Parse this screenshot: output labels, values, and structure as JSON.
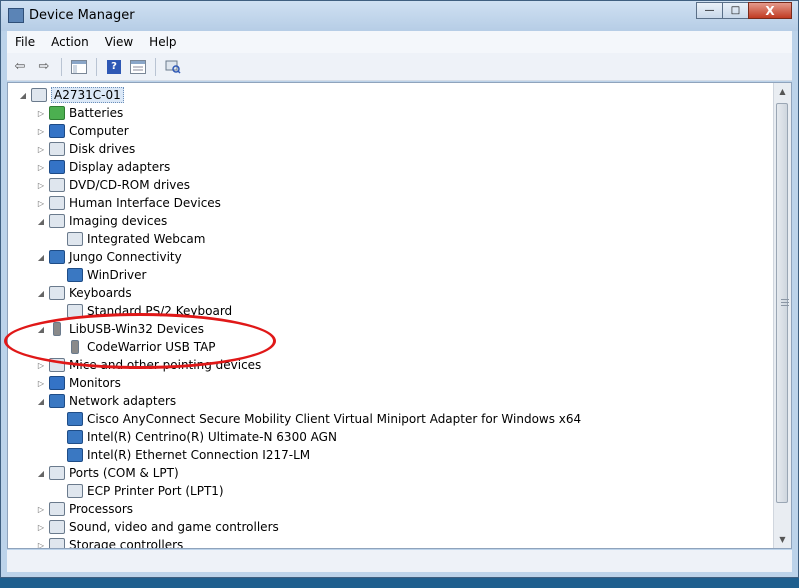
{
  "window": {
    "title": "Device Manager",
    "minimize_glyph": "—",
    "maximize_glyph": "□",
    "close_glyph": "X"
  },
  "menu": [
    "File",
    "Action",
    "View",
    "Help"
  ],
  "toolbar": {
    "back_glyph": "⇦",
    "forward_glyph": "⇨",
    "help_glyph": "?"
  },
  "tree": [
    {
      "label": "A2731C-01",
      "depth": 0,
      "expander": "◢",
      "icon": "computer-icon",
      "selected": true
    },
    {
      "label": "Batteries",
      "depth": 1,
      "expander": "▷",
      "icon": "battery-icon"
    },
    {
      "label": "Computer",
      "depth": 1,
      "expander": "▷",
      "icon": "monitor-icon"
    },
    {
      "label": "Disk drives",
      "depth": 1,
      "expander": "▷",
      "icon": "disk-drive-icon"
    },
    {
      "label": "Display adapters",
      "depth": 1,
      "expander": "▷",
      "icon": "display-adapter-icon"
    },
    {
      "label": "DVD/CD-ROM drives",
      "depth": 1,
      "expander": "▷",
      "icon": "dvd-drive-icon"
    },
    {
      "label": "Human Interface Devices",
      "depth": 1,
      "expander": "▷",
      "icon": "hid-icon"
    },
    {
      "label": "Imaging devices",
      "depth": 1,
      "expander": "◢",
      "icon": "camera-icon"
    },
    {
      "label": "Integrated Webcam",
      "depth": 2,
      "expander": "",
      "icon": "camera-icon"
    },
    {
      "label": "Jungo Connectivity",
      "depth": 1,
      "expander": "◢",
      "icon": "network-icon"
    },
    {
      "label": "WinDriver",
      "depth": 2,
      "expander": "",
      "icon": "network-icon"
    },
    {
      "label": "Keyboards",
      "depth": 1,
      "expander": "◢",
      "icon": "keyboard-icon"
    },
    {
      "label": "Standard PS/2 Keyboard",
      "depth": 2,
      "expander": "",
      "icon": "keyboard-icon"
    },
    {
      "label": "LibUSB-Win32 Devices",
      "depth": 1,
      "expander": "◢",
      "icon": "usb-icon"
    },
    {
      "label": "CodeWarrior USB TAP",
      "depth": 2,
      "expander": "",
      "icon": "usb-icon"
    },
    {
      "label": "Mice and other pointing devices",
      "depth": 1,
      "expander": "▷",
      "icon": "mouse-icon"
    },
    {
      "label": "Monitors",
      "depth": 1,
      "expander": "▷",
      "icon": "monitor-icon"
    },
    {
      "label": "Network adapters",
      "depth": 1,
      "expander": "◢",
      "icon": "network-icon"
    },
    {
      "label": "Cisco AnyConnect Secure Mobility Client Virtual Miniport Adapter for Windows x64",
      "depth": 2,
      "expander": "",
      "icon": "network-icon"
    },
    {
      "label": "Intel(R) Centrino(R) Ultimate-N 6300 AGN",
      "depth": 2,
      "expander": "",
      "icon": "network-icon"
    },
    {
      "label": "Intel(R) Ethernet Connection I217-LM",
      "depth": 2,
      "expander": "",
      "icon": "network-icon"
    },
    {
      "label": "Ports (COM & LPT)",
      "depth": 1,
      "expander": "◢",
      "icon": "port-icon"
    },
    {
      "label": "ECP Printer Port (LPT1)",
      "depth": 2,
      "expander": "",
      "icon": "port-icon"
    },
    {
      "label": "Processors",
      "depth": 1,
      "expander": "▷",
      "icon": "processor-icon"
    },
    {
      "label": "Sound, video and game controllers",
      "depth": 1,
      "expander": "▷",
      "icon": "sound-icon"
    },
    {
      "label": "Storage controllers",
      "depth": 1,
      "expander": "▷",
      "icon": "storage-icon"
    }
  ],
  "scrollbar": {
    "up_glyph": "▲",
    "down_glyph": "▼"
  },
  "annotation_color": "#e01818"
}
